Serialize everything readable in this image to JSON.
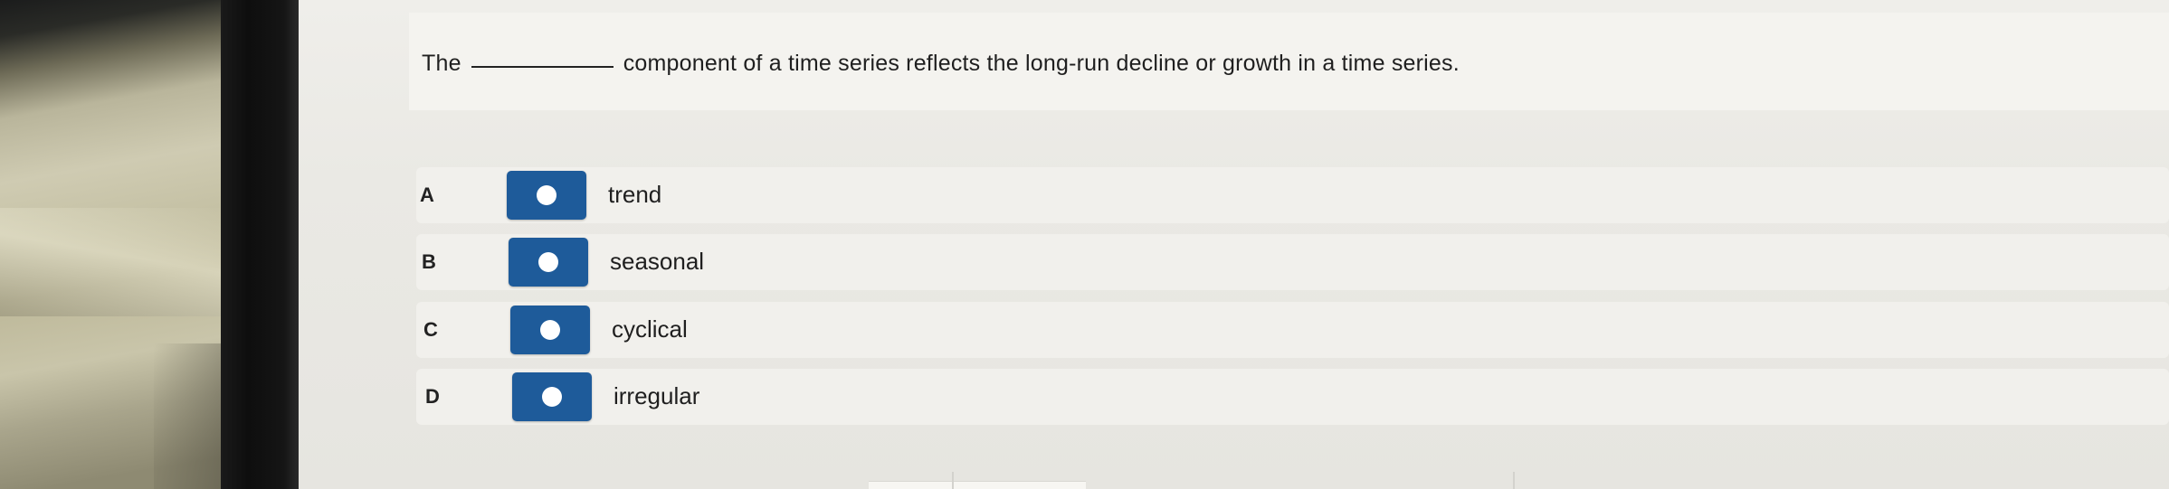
{
  "question": {
    "prefix": "The",
    "suffix": "component of a time series reflects the long-run decline or growth in a time series."
  },
  "options": [
    {
      "letter": "A",
      "label": "trend"
    },
    {
      "letter": "B",
      "label": "seasonal"
    },
    {
      "letter": "C",
      "label": "cyclical"
    },
    {
      "letter": "D",
      "label": "irregular"
    }
  ],
  "colors": {
    "radio_button": "#1e5b9a",
    "radio_dot": "#ffffff"
  },
  "icons": {
    "radio": "radio-dot-icon"
  }
}
